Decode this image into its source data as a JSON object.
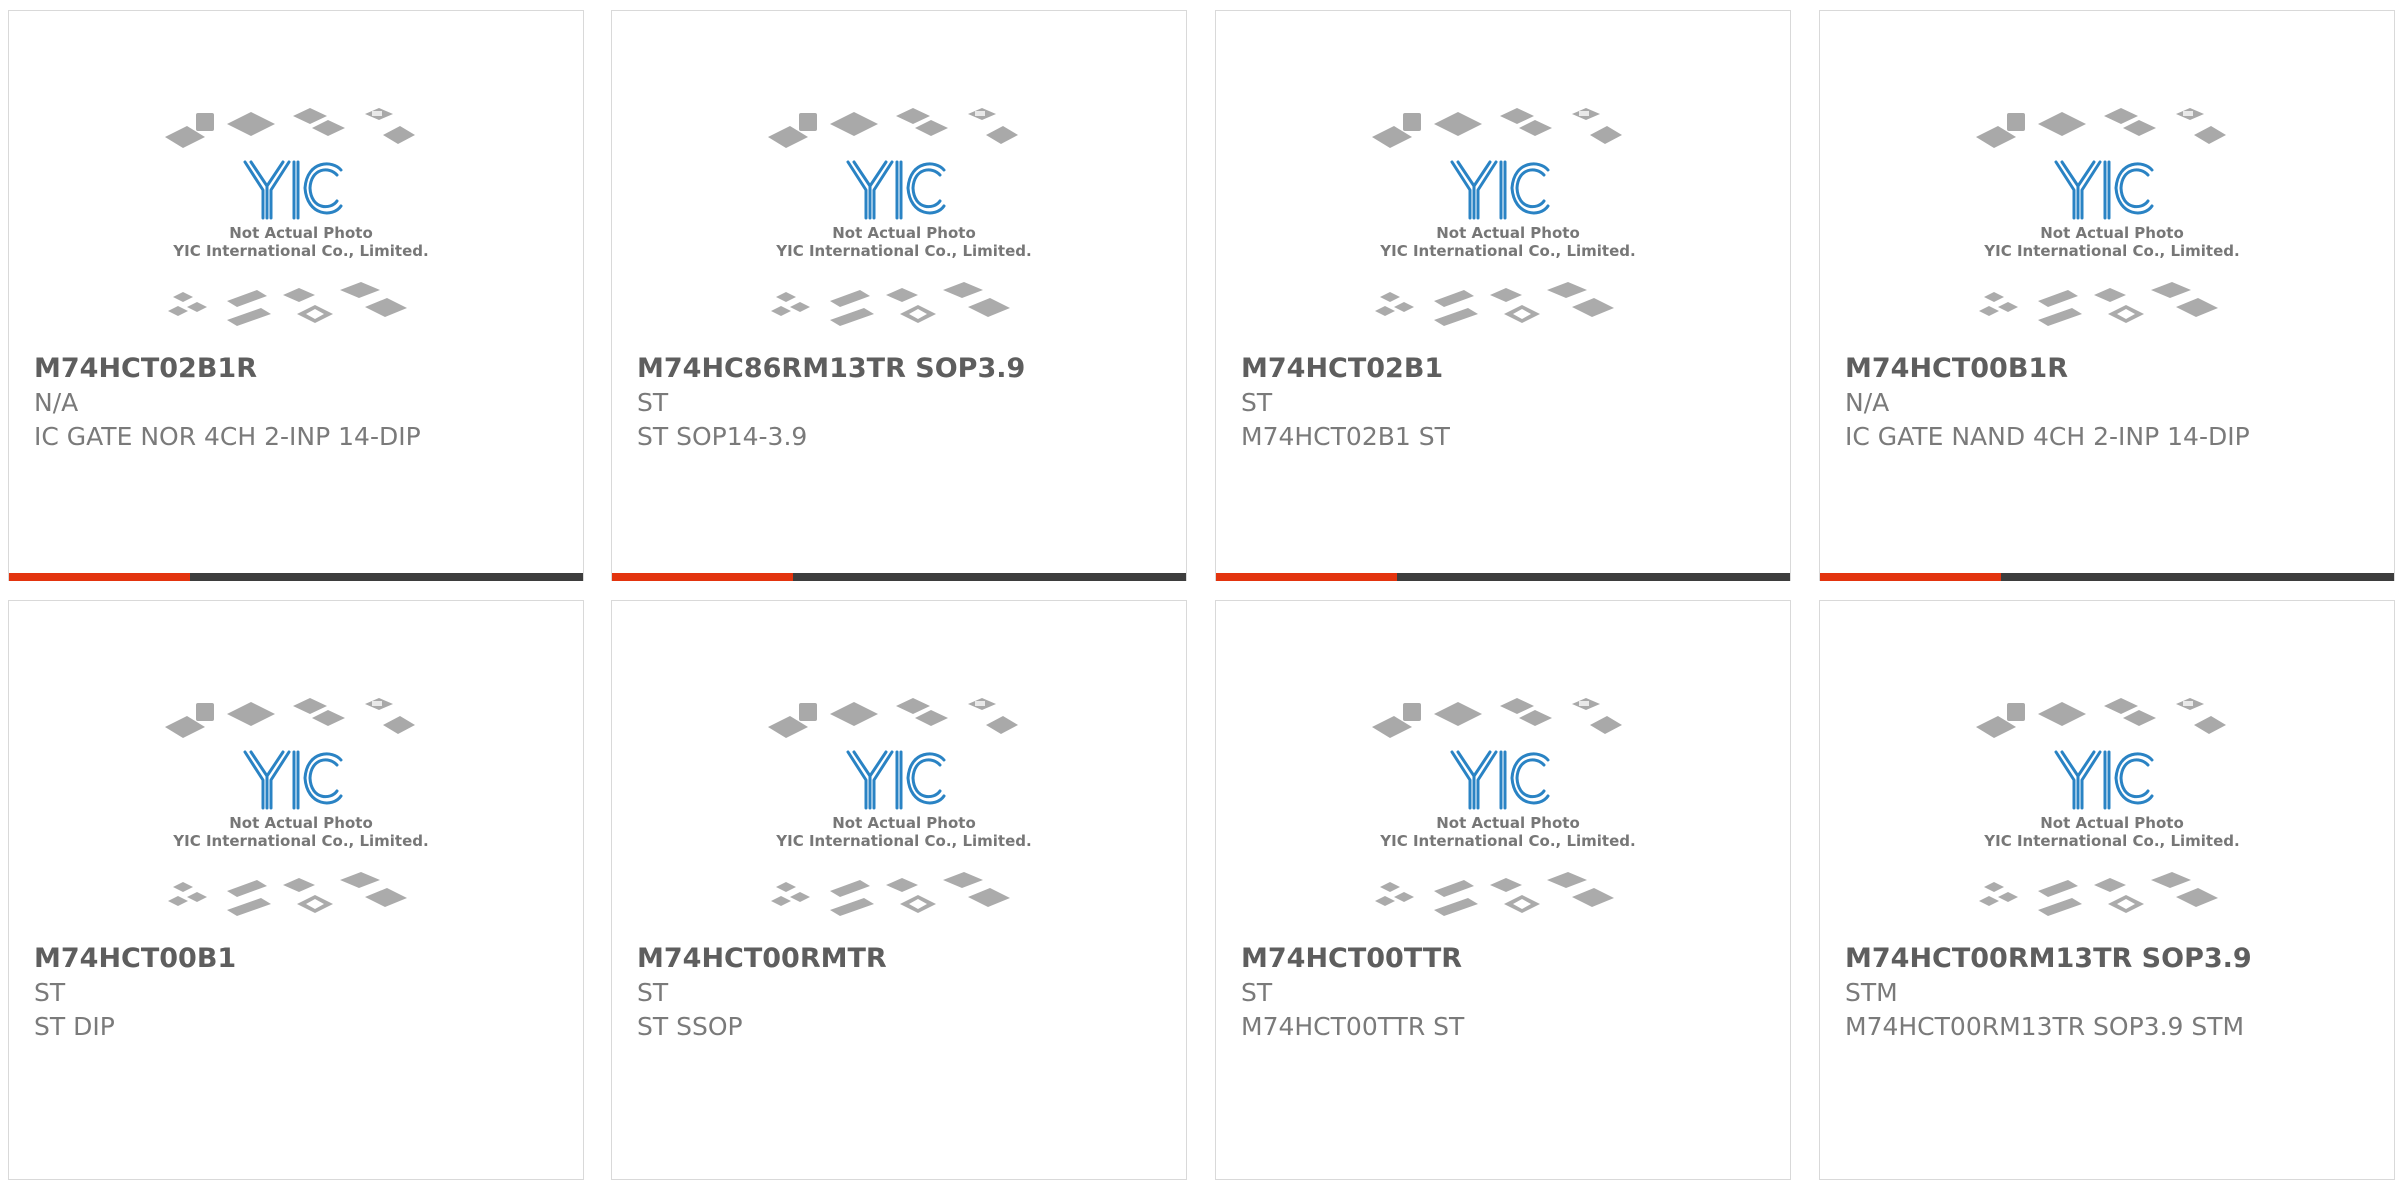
{
  "placeholder": {
    "line1": "Not Actual Photo",
    "line2": "YIC International Co., Limited.",
    "logo": "YIC"
  },
  "colors": {
    "accent": "#e3340e",
    "bar": "#3d3d3d",
    "logo": "#2a83c4"
  },
  "products": [
    {
      "part": "M74HCT02B1R",
      "manufacturer": "N/A",
      "description": "IC GATE NOR 4CH 2-INP 14-DIP"
    },
    {
      "part": "M74HC86RM13TR SOP3.9",
      "manufacturer": "ST",
      "description": "ST SOP14-3.9"
    },
    {
      "part": "M74HCT02B1",
      "manufacturer": "ST",
      "description": "M74HCT02B1 ST"
    },
    {
      "part": "M74HCT00B1R",
      "manufacturer": "N/A",
      "description": "IC GATE NAND 4CH 2-INP 14-DIP"
    },
    {
      "part": "M74HCT00B1",
      "manufacturer": "ST",
      "description": "ST DIP"
    },
    {
      "part": "M74HCT00RMTR",
      "manufacturer": "ST",
      "description": "ST SSOP"
    },
    {
      "part": "M74HCT00TTR",
      "manufacturer": "ST",
      "description": "M74HCT00TTR ST"
    },
    {
      "part": "M74HCT00RM13TR SOP3.9",
      "manufacturer": "STM",
      "description": "M74HCT00RM13TR SOP3.9 STM"
    }
  ]
}
